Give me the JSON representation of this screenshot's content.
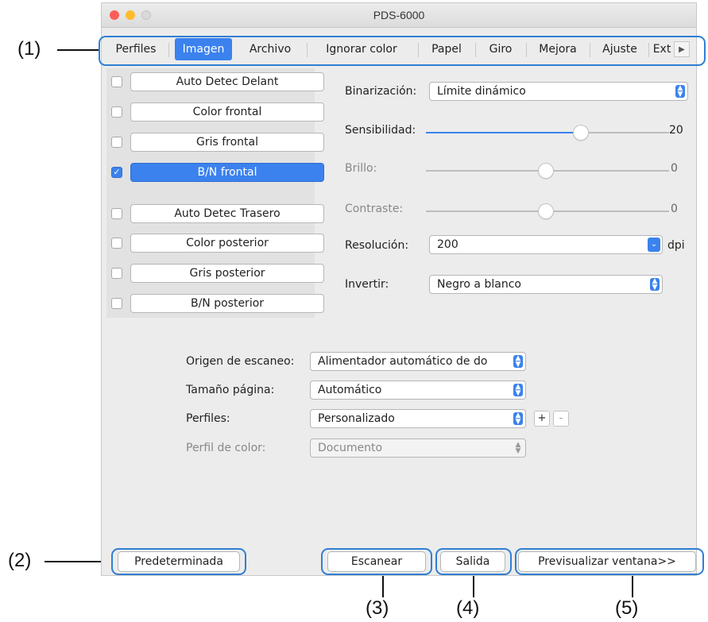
{
  "window": {
    "title": "PDS-6000",
    "traffic_colors": [
      "#fc5f57",
      "#fdbc2e",
      "#d9d9d9"
    ]
  },
  "tabs": [
    {
      "label": "Perfiles",
      "active": false
    },
    {
      "label": "Imagen",
      "active": true
    },
    {
      "label": "Archivo",
      "active": false
    },
    {
      "label": "Ignorar color",
      "active": false
    },
    {
      "label": "Papel",
      "active": false
    },
    {
      "label": "Giro",
      "active": false
    },
    {
      "label": "Mejora",
      "active": false
    },
    {
      "label": "Ajuste",
      "active": false
    },
    {
      "label": "Ext",
      "active": false
    }
  ],
  "image_sides": [
    {
      "label": "Auto Detec Delant",
      "checked": false
    },
    {
      "label": "Color frontal",
      "checked": false
    },
    {
      "label": "Gris frontal",
      "checked": false
    },
    {
      "label": "B/N frontal",
      "checked": true
    },
    {
      "label": "Auto Detec Trasero",
      "checked": false
    },
    {
      "label": "Color posterior",
      "checked": false
    },
    {
      "label": "Gris posterior",
      "checked": false
    },
    {
      "label": "B/N posterior",
      "checked": false
    }
  ],
  "settings": {
    "binarizacion_label": "Binarización:",
    "binarizacion_value": "Límite dinámico",
    "sensibilidad_label": "Sensibilidad:",
    "sensibilidad_value": "20",
    "brillo_label": "Brillo:",
    "brillo_value": "0",
    "contraste_label": "Contraste:",
    "contraste_value": "0",
    "resolucion_label": "Resolución:",
    "resolucion_value": "200",
    "resolucion_unit": "dpi",
    "invertir_label": "Invertir:",
    "invertir_value": "Negro a blanco"
  },
  "scan": {
    "origen_label": "Origen de escaneo:",
    "origen_value": "Alimentador automático de do",
    "tamano_label": "Tamaño página:",
    "tamano_value": "Automático",
    "perfiles_label": "Perfiles:",
    "perfiles_value": "Personalizado",
    "add_label": "+",
    "remove_label": "-",
    "perfil_color_label": "Perfil de color:",
    "perfil_color_value": "Documento"
  },
  "buttons": {
    "default": "Predeterminada",
    "scan": "Escanear",
    "exit": "Salida",
    "preview": "Previsualizar ventana>>"
  },
  "callouts": {
    "c1": "(1)",
    "c2": "(2)",
    "c3": "(3)",
    "c4": "(4)",
    "c5": "(5)"
  },
  "colors": {
    "accent": "#3b82ee",
    "highlight": "#2f7fd3"
  }
}
